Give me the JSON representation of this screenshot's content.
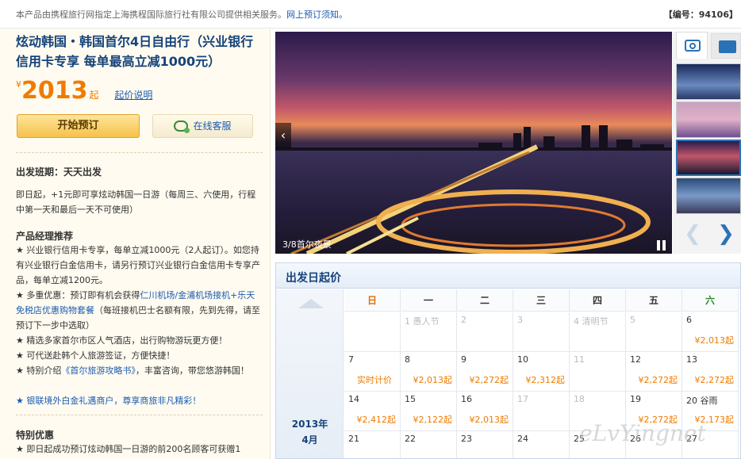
{
  "notice": {
    "text": "本产品由携程旅行网指定上海携程国际旅行社有限公司提供相关服务。",
    "link": "网上预订须知。",
    "code": "【编号：94106】"
  },
  "product": {
    "title": "炫动韩国・韩国首尔4日自由行（兴业银行信用卡专享  每单最高立减1000元）",
    "price_currency": "¥",
    "price": "2013",
    "price_suffix": "起",
    "price_note": "起价说明",
    "book_button": "开始预订",
    "service_button": "在线客服"
  },
  "departure": {
    "label": "出发班期：天天出发",
    "text": "即日起，+1元即可享炫动韩国一日游（每周三、六使用，行程中第一天和最后一天不可使用）"
  },
  "recommend": {
    "label": "产品经理推荐",
    "items": [
      {
        "a": "★ 兴业银行信用卡专享，每单立减1000元（2人起订）。如您持有兴业银行白金信用卡，请另行预订兴业银行白金信用卡专享产品，每单立减1200元。"
      },
      {
        "a": "★ 多重优惠：预订即有机会获得",
        "b": "仁川机场/金浦机场接机+乐天免税店优惠购物套餐",
        "c": "（每班接机巴士名额有限，先到先得，请至预订下一步中选取）"
      },
      {
        "a": "★ 精选多家首尔市区人气酒店，出行购物游玩更方便！"
      },
      {
        "a": "★ 可代送赴韩个人旅游签证，方便快捷！"
      },
      {
        "a": "★ 特别介绍",
        "b": "《首尔旅游攻略书》",
        "c": "，丰富咨询，带您悠游韩国！"
      },
      {
        "b": "★ 银联境外白金礼遇商户，尊享商旅非凡精彩！"
      }
    ]
  },
  "special": {
    "label": "特别优惠",
    "text": "★ 即日起成功预订炫动韩国一日游的前200名顾客可获赠1"
  },
  "gallery": {
    "caption": "3/8首尔夜景",
    "prev_icon": "‹",
    "thumb_prev": "❮",
    "thumb_next": "❯"
  },
  "calendar": {
    "title": "出发日起价",
    "year": "2013年",
    "month": "4月",
    "weekdays": [
      "日",
      "一",
      "二",
      "三",
      "四",
      "五",
      "六"
    ],
    "weekday_colors": [
      "#e07000",
      "#333333",
      "#333333",
      "#333333",
      "#333333",
      "#333333",
      "#2a8a2a"
    ],
    "rows": [
      [
        {
          "d": "",
          "p": ""
        },
        {
          "d": "1 愚人节",
          "p": "",
          "dim": true
        },
        {
          "d": "2",
          "p": "",
          "dim": true
        },
        {
          "d": "3",
          "p": "",
          "dim": true
        },
        {
          "d": "4 清明节",
          "p": "",
          "dim": true
        },
        {
          "d": "5",
          "p": "",
          "dim": true
        },
        {
          "d": "6",
          "p": "¥2,013起"
        }
      ],
      [
        {
          "d": "7",
          "p": "实时计价",
          "real": true
        },
        {
          "d": "8",
          "p": "¥2,013起"
        },
        {
          "d": "9",
          "p": "¥2,272起"
        },
        {
          "d": "10",
          "p": "¥2,312起"
        },
        {
          "d": "11",
          "p": "",
          "dim": true
        },
        {
          "d": "12",
          "p": "¥2,272起"
        },
        {
          "d": "13",
          "p": "¥2,272起"
        }
      ],
      [
        {
          "d": "14",
          "p": "¥2,412起"
        },
        {
          "d": "15",
          "p": "¥2,122起"
        },
        {
          "d": "16",
          "p": "¥2,013起"
        },
        {
          "d": "17",
          "p": "",
          "dim": true
        },
        {
          "d": "18",
          "p": "",
          "dim": true
        },
        {
          "d": "19",
          "p": "¥2,272起"
        },
        {
          "d": "20 谷雨",
          "p": "¥2,173起"
        }
      ],
      [
        {
          "d": "21",
          "p": ""
        },
        {
          "d": "22",
          "p": ""
        },
        {
          "d": "23",
          "p": ""
        },
        {
          "d": "24",
          "p": ""
        },
        {
          "d": "25",
          "p": ""
        },
        {
          "d": "26",
          "p": ""
        },
        {
          "d": "27",
          "p": ""
        }
      ]
    ]
  },
  "watermark": "eLvYingnet"
}
